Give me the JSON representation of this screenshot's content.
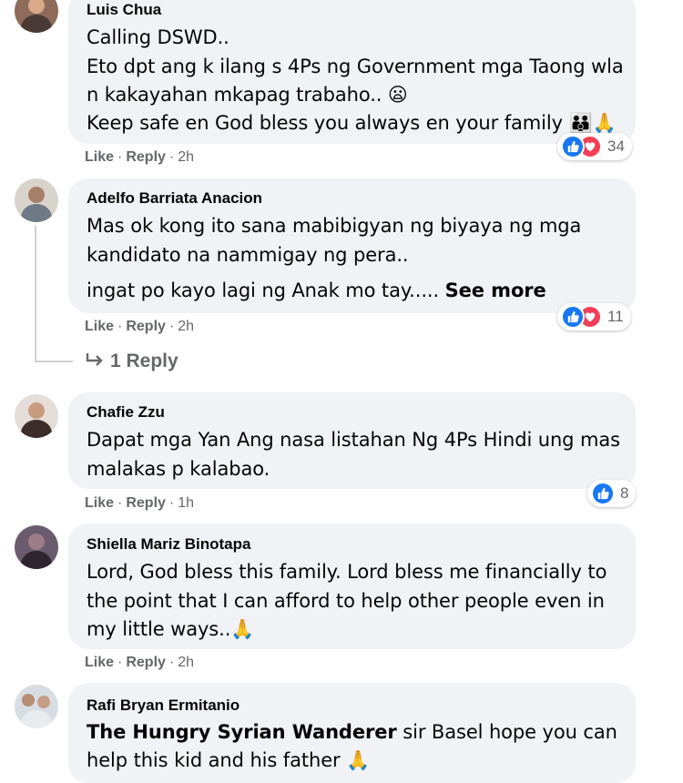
{
  "colors": {
    "bubble_bg": "#f0f2f5",
    "meta_text": "#65676b",
    "like_blue": "#1877f2",
    "love_red": "#f33e58"
  },
  "comments": [
    {
      "author": "Luis Chua",
      "lines": [
        "Calling DSWD..",
        "Eto dpt ang k ilang s 4Ps ng Government mga Taong wla",
        "n kakayahan mkapag trabaho.. 😦",
        "Keep safe en God bless you always en your family 👪🙏"
      ],
      "actions": {
        "like": "Like",
        "reply": "Reply",
        "time": "2h"
      },
      "reactions": {
        "icons": [
          "like-icon",
          "love-icon"
        ],
        "count": "34"
      }
    },
    {
      "author": "Adelfo Barriata Anacion",
      "lines": [
        "Mas ok kong ito sana mabibigyan ng biyaya ng mga",
        "kandidato na nammigay ng pera..",
        "ingat po kayo lagi ng Anak mo tay....."
      ],
      "see_more": "See more",
      "actions": {
        "like": "Like",
        "reply": "Reply",
        "time": "2h"
      },
      "reactions": {
        "icons": [
          "like-icon",
          "love-icon"
        ],
        "count": "11"
      },
      "replies_link": "1 Reply"
    },
    {
      "author": "Chafie Zzu",
      "lines": [
        "Dapat mga Yan Ang nasa listahan Ng 4Ps Hindi ung mas",
        "malakas p kalabao."
      ],
      "actions": {
        "like": "Like",
        "reply": "Reply",
        "time": "1h"
      },
      "reactions": {
        "icons": [
          "like-icon"
        ],
        "count": "8"
      }
    },
    {
      "author": "Shiella Mariz Binotapa",
      "lines": [
        "Lord, God bless this family. Lord bless me financially to",
        "the point that I can afford to help other people even in",
        "my little ways..🙏"
      ],
      "actions": {
        "like": "Like",
        "reply": "Reply",
        "time": "2h"
      }
    },
    {
      "author": "Rafi Bryan Ermitanio",
      "mention": "The Hungry Syrian Wanderer",
      "lines": [
        " sir Basel hope you can",
        "help this kid and his father 🙏"
      ]
    }
  ]
}
